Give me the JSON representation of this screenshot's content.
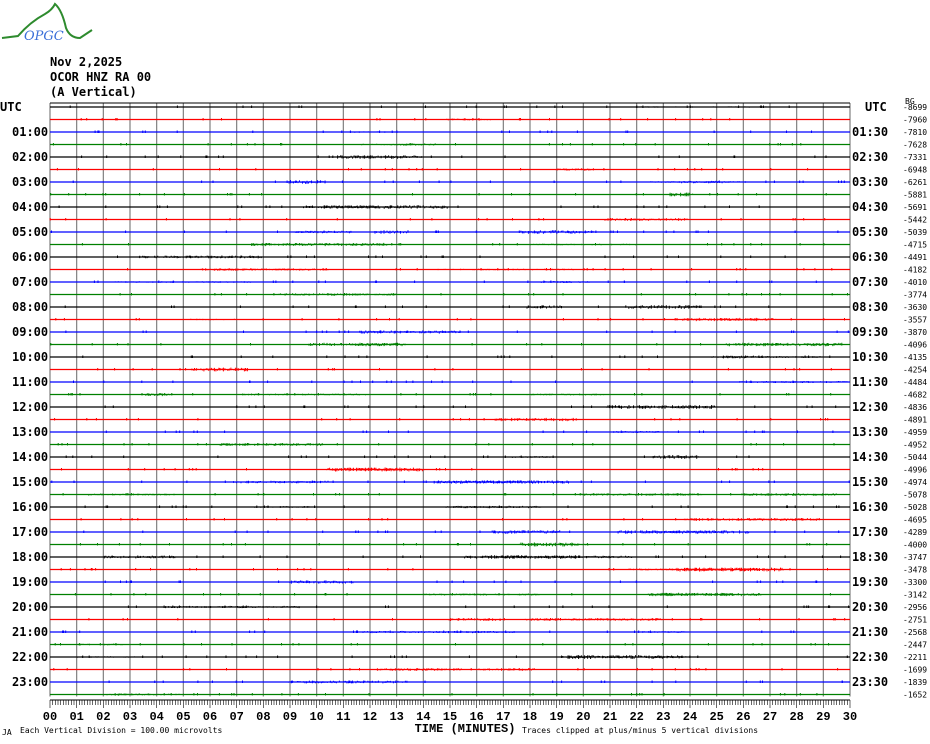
{
  "logo": {
    "text": "OPGC",
    "colors": {
      "curve": "#2e8b2e",
      "text": "#3a6fd8"
    }
  },
  "header": {
    "date": "Nov 2,2025",
    "station": "OCOR HNZ RA 00",
    "component": "(A Vertical)"
  },
  "chart_data": {
    "type": "line",
    "subtype": "helicorder",
    "trace_colors": [
      "#000000",
      "#ff0000",
      "#0000ff",
      "#008000"
    ],
    "grid": true,
    "left_labels": [
      "UTC",
      "01:00",
      "02:00",
      "03:00",
      "04:00",
      "05:00",
      "06:00",
      "07:00",
      "08:00",
      "09:00",
      "10:00",
      "11:00",
      "12:00",
      "13:00",
      "14:00",
      "15:00",
      "16:00",
      "17:00",
      "18:00",
      "19:00",
      "20:00",
      "21:00",
      "22:00",
      "23:00"
    ],
    "right_labels": [
      "UTC",
      "01:30",
      "02:30",
      "03:30",
      "04:30",
      "05:30",
      "06:30",
      "07:30",
      "08:30",
      "09:30",
      "10:30",
      "11:30",
      "12:30",
      "13:30",
      "14:30",
      "15:30",
      "16:30",
      "17:30",
      "18:30",
      "19:30",
      "20:30",
      "21:30",
      "22:30",
      "23:30"
    ],
    "right_values": [
      "-8699",
      "-7960",
      "-7810",
      "-7628",
      "-7331",
      "-6948",
      "-6261",
      "-5881",
      "-5691",
      "-5442",
      "-5039",
      "-4715",
      "-4491",
      "-4182",
      "-4010",
      "-3774",
      "-3630",
      "-3557",
      "-3870",
      "-4096",
      "-4135",
      "-4254",
      "-4484",
      "-4682",
      "-4836",
      "-4891",
      "-4959",
      "-4952",
      "-5044",
      "-4996",
      "-4974",
      "-5078",
      "-5028",
      "-4695",
      "-4289",
      "-4000",
      "-3747",
      "-3478",
      "-3300",
      "-3142",
      "-2956",
      "-2751",
      "-2568",
      "-2447",
      "-2211",
      "-1699",
      "-1839",
      "-1652"
    ],
    "right_top_tag": "BG",
    "x_ticks": [
      "00",
      "01",
      "02",
      "03",
      "04",
      "05",
      "06",
      "07",
      "08",
      "09",
      "10",
      "11",
      "12",
      "13",
      "14",
      "15",
      "16",
      "17",
      "18",
      "19",
      "20",
      "21",
      "22",
      "23",
      "24",
      "25",
      "26",
      "27",
      "28",
      "29",
      "30"
    ],
    "xlabel": "TIME (MINUTES)",
    "xlim": [
      0,
      30
    ],
    "footer_left_mark": "JA",
    "footer_scale": "Each Vertical Division =  100.00 microvolts",
    "footer_clip": "Traces clipped at plus/minus 5 vertical divisions"
  }
}
